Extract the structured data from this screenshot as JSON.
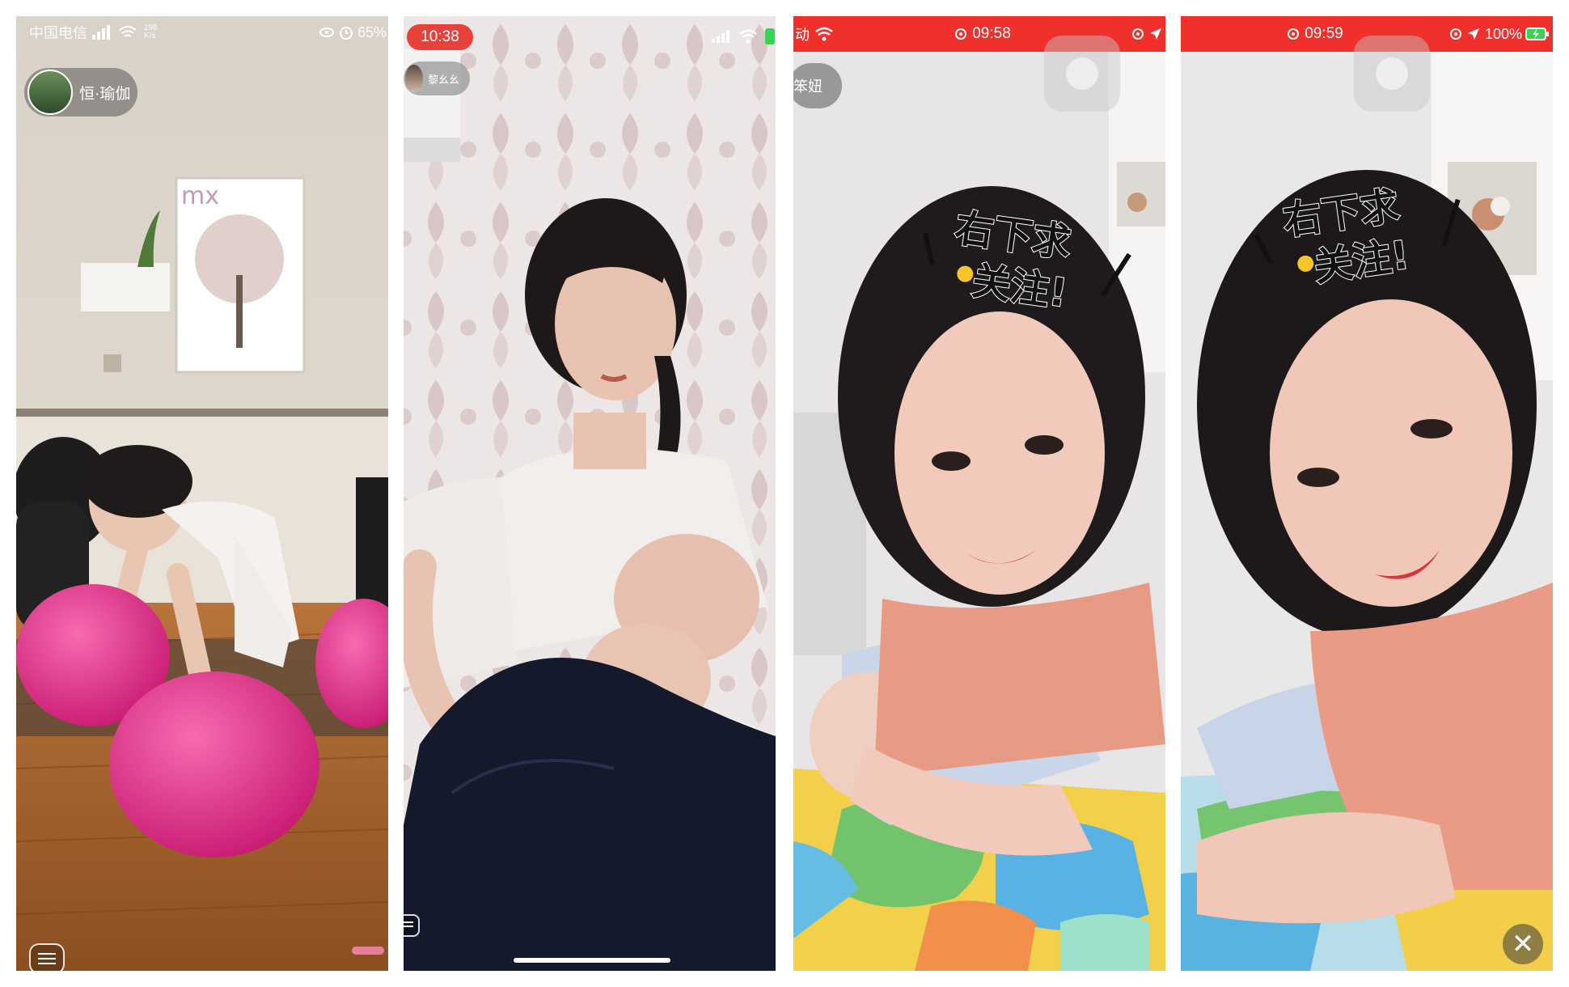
{
  "panels": [
    {
      "status": {
        "carrier": "中国电信",
        "speed_value": "298",
        "speed_unit": "K/s",
        "battery": "65%"
      },
      "user": {
        "name": "恒·瑜伽"
      },
      "wall_logo": "mx"
    },
    {
      "status": {
        "time": "10:38"
      },
      "user": {
        "name": "黎幺幺"
      }
    },
    {
      "status": {
        "left_text": "动",
        "time": "09:58"
      },
      "user": {
        "name": "笨妞"
      },
      "sticker": {
        "line1": "右下求",
        "line2": "关注!"
      }
    },
    {
      "status": {
        "time": "09:59",
        "battery": "100%"
      },
      "sticker": {
        "line1": "右下求",
        "line2": "关注!"
      }
    }
  ],
  "colors": {
    "status_red": "#f0312b",
    "pill_red": "#e8413a",
    "yoga_ball": "#e62e8a"
  },
  "icons": [
    "wifi-icon",
    "signal-icon",
    "battery-icon",
    "alarm-icon",
    "location-icon",
    "message-icon",
    "close-icon"
  ]
}
